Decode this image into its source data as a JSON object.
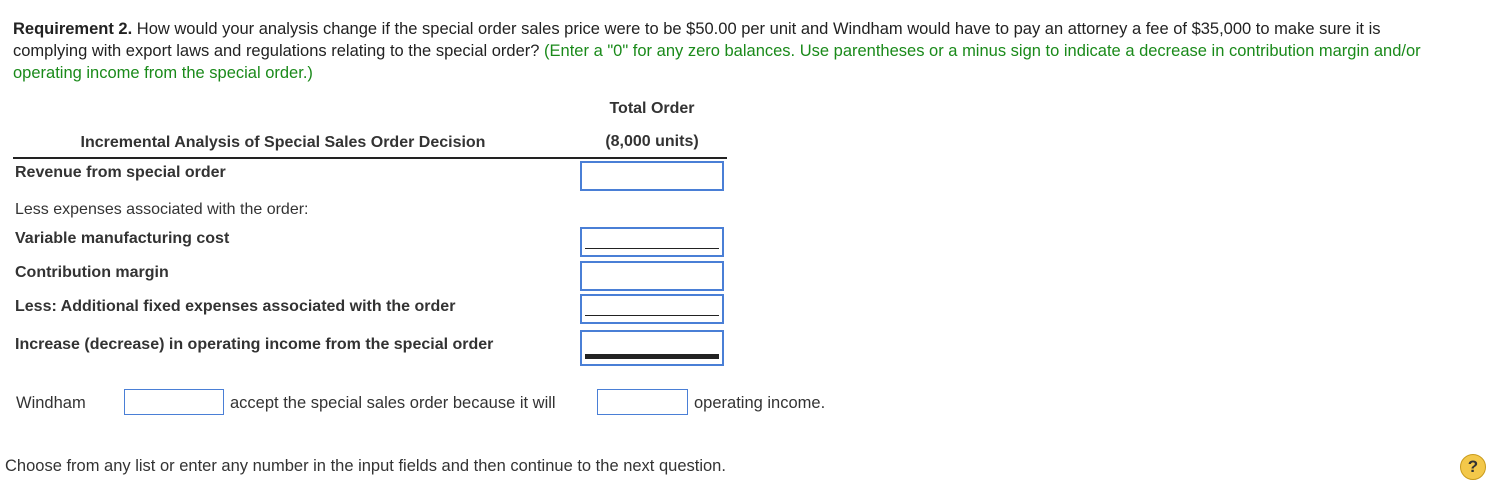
{
  "requirement": {
    "label": "Requirement 2.",
    "question": " How would your analysis change if the special order sales price were to be $50.00 per unit and Windham would have to pay an attorney a fee of $35,000 to make sure it is complying with export laws and regulations relating to the special order? ",
    "instruction": "(Enter a \"0\" for any zero balances. Use parentheses or a minus sign to indicate a decrease in contribution margin and/or operating income from the special order.)"
  },
  "table": {
    "column_header_line1": "Total Order",
    "column_header_line2": "(8,000 units)",
    "title": "Incremental Analysis of Special Sales Order Decision",
    "rows": [
      {
        "label": "Revenue from special order",
        "value": ""
      },
      {
        "label": "Less expenses associated with the order:"
      },
      {
        "label": "Variable manufacturing cost",
        "value": ""
      },
      {
        "label": "Contribution margin",
        "value": ""
      },
      {
        "label": "Less: Additional fixed expenses associated with the order",
        "value": ""
      },
      {
        "label": "Increase (decrease) in operating income from the special order",
        "value": ""
      }
    ]
  },
  "conclusion": {
    "subject": "Windham",
    "select1_value": "",
    "middle": "accept the special sales order because it will",
    "select2_value": "",
    "end": "operating income."
  },
  "footer": {
    "instruction": "Choose from any list or enter any number in the input fields and then continue to the next question.",
    "help_symbol": "?"
  },
  "colors": {
    "instruction_green": "#1a8a1a",
    "input_border_blue": "#4a7fd6",
    "help_yellow": "#f3c84a"
  }
}
